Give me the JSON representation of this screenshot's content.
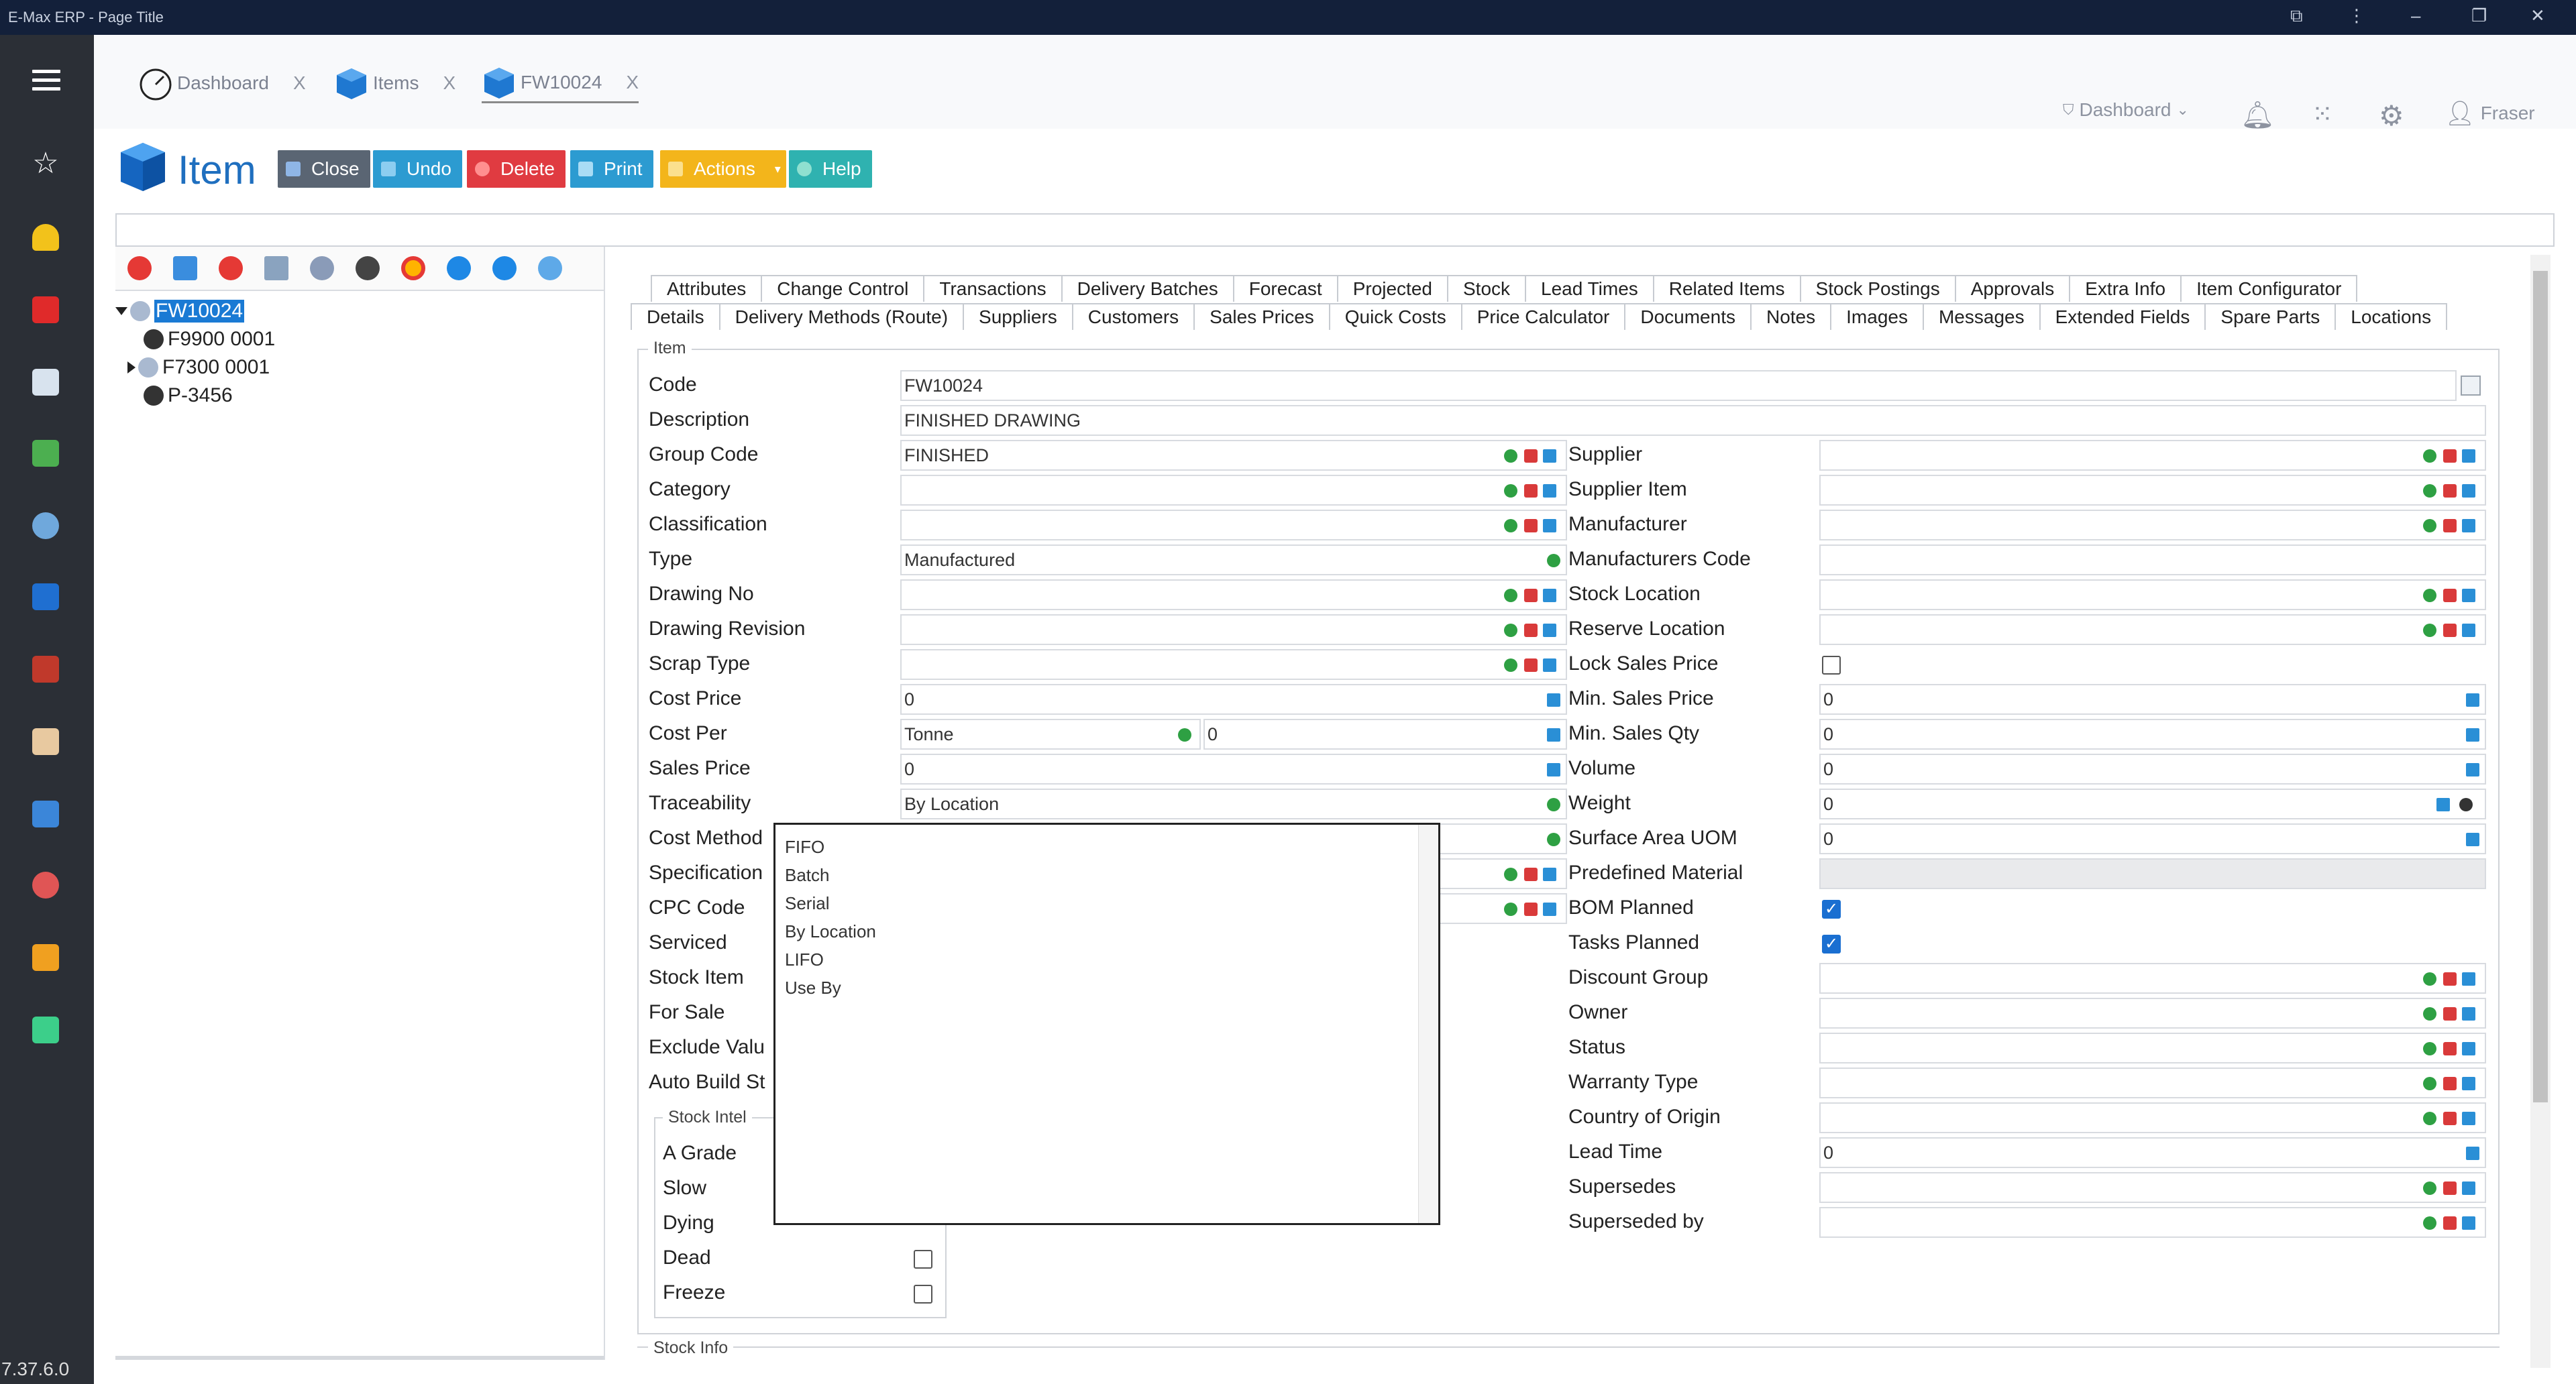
{
  "window": {
    "title": "E-Max ERP - Page Title"
  },
  "nav_tabs": [
    {
      "label": "Dashboard",
      "close": "X"
    },
    {
      "label": "Items",
      "close": "X"
    },
    {
      "label": "FW10024",
      "close": "X"
    }
  ],
  "topright": {
    "dashboard": "Dashboard",
    "user": "Fraser"
  },
  "module": {
    "title": "Item"
  },
  "toolbar": {
    "close": "Close",
    "undo": "Undo",
    "delete": "Delete",
    "print": "Print",
    "actions": "Actions",
    "help": "Help"
  },
  "tree": {
    "root": "FW10024",
    "children": [
      "F9900 0001",
      "F7300 0001",
      "P-3456"
    ]
  },
  "tabs_row1": [
    "Attributes",
    "Change Control",
    "Transactions",
    "Delivery Batches",
    "Forecast",
    "Projected",
    "Stock",
    "Lead Times",
    "Related Items",
    "Stock Postings",
    "Approvals",
    "Extra Info",
    "Item Configurator"
  ],
  "tabs_row2": [
    "Details",
    "Delivery Methods (Route)",
    "Suppliers",
    "Customers",
    "Sales Prices",
    "Quick Costs",
    "Price Calculator",
    "Documents",
    "Notes",
    "Images",
    "Messages",
    "Extended Fields",
    "Spare Parts",
    "Locations"
  ],
  "fieldset": {
    "item": "Item",
    "stock_intel": "Stock Intel",
    "stock_info": "Stock Info"
  },
  "left_fields": {
    "code": {
      "label": "Code",
      "value": "FW10024"
    },
    "description": {
      "label": "Description",
      "value": "FINISHED DRAWING"
    },
    "group_code": {
      "label": "Group Code",
      "value": "FINISHED"
    },
    "category": {
      "label": "Category",
      "value": ""
    },
    "classification": {
      "label": "Classification",
      "value": ""
    },
    "type": {
      "label": "Type",
      "value": "Manufactured"
    },
    "drawing_no": {
      "label": "Drawing No",
      "value": ""
    },
    "drawing_revision": {
      "label": "Drawing Revision",
      "value": ""
    },
    "scrap_type": {
      "label": "Scrap Type",
      "value": ""
    },
    "cost_price": {
      "label": "Cost Price",
      "value": "0"
    },
    "cost_per": {
      "label": "Cost Per",
      "value": "Tonne",
      "value2": "0"
    },
    "sales_price": {
      "label": "Sales Price",
      "value": "0"
    },
    "traceability": {
      "label": "Traceability",
      "value": "By Location"
    },
    "cost_method": {
      "label": "Cost Method"
    },
    "specification": {
      "label": "Specification"
    },
    "cpc_code": {
      "label": "CPC Code"
    },
    "serviced": {
      "label": "Serviced"
    },
    "stock_item": {
      "label": "Stock Item"
    },
    "for_sale": {
      "label": "For Sale"
    },
    "exclude_value": {
      "label": "Exclude Valu"
    },
    "auto_build": {
      "label": "Auto Build St"
    }
  },
  "stock_intel": [
    "A Grade",
    "Slow",
    "Dying",
    "Dead",
    "Freeze"
  ],
  "right_fields": {
    "supplier": {
      "label": "Supplier",
      "value": ""
    },
    "supplier_item": {
      "label": "Supplier Item",
      "value": ""
    },
    "manufacturer": {
      "label": "Manufacturer",
      "value": ""
    },
    "manufacturers_code": {
      "label": "Manufacturers Code",
      "value": ""
    },
    "stock_location": {
      "label": "Stock Location",
      "value": ""
    },
    "reserve_location": {
      "label": "Reserve Location",
      "value": ""
    },
    "lock_sales_price": {
      "label": "Lock Sales Price"
    },
    "min_sales_price": {
      "label": "Min. Sales Price",
      "value": "0"
    },
    "min_sales_qty": {
      "label": "Min. Sales Qty",
      "value": "0"
    },
    "volume": {
      "label": "Volume",
      "value": "0"
    },
    "weight": {
      "label": "Weight",
      "value": "0"
    },
    "surface_area_uom": {
      "label": "Surface Area UOM",
      "value": "0"
    },
    "predefined_material": {
      "label": "Predefined Material",
      "value": ""
    },
    "bom_planned": {
      "label": "BOM Planned"
    },
    "tasks_planned": {
      "label": "Tasks Planned"
    },
    "discount_group": {
      "label": "Discount Group",
      "value": ""
    },
    "owner": {
      "label": "Owner",
      "value": ""
    },
    "status": {
      "label": "Status",
      "value": ""
    },
    "warranty_type": {
      "label": "Warranty Type",
      "value": ""
    },
    "country_of_origin": {
      "label": "Country of Origin",
      "value": ""
    },
    "lead_time": {
      "label": "Lead Time",
      "value": "0"
    },
    "supersedes": {
      "label": "Supersedes",
      "value": ""
    },
    "superseded_by": {
      "label": "Superseded by",
      "value": ""
    }
  },
  "dropdown_options": [
    "FIFO",
    "Batch",
    "Serial",
    "By Location",
    "LIFO",
    "Use By"
  ],
  "version": "7.37.6.0",
  "colors": {
    "close": "#5a6573",
    "undo": "#2c9bd1",
    "delete": "#e03b41",
    "print": "#2c9bd1",
    "actions": "#f3b51b",
    "help": "#2fb2b0",
    "titlebar": "#13203a",
    "sidebar": "#2b2f36"
  }
}
